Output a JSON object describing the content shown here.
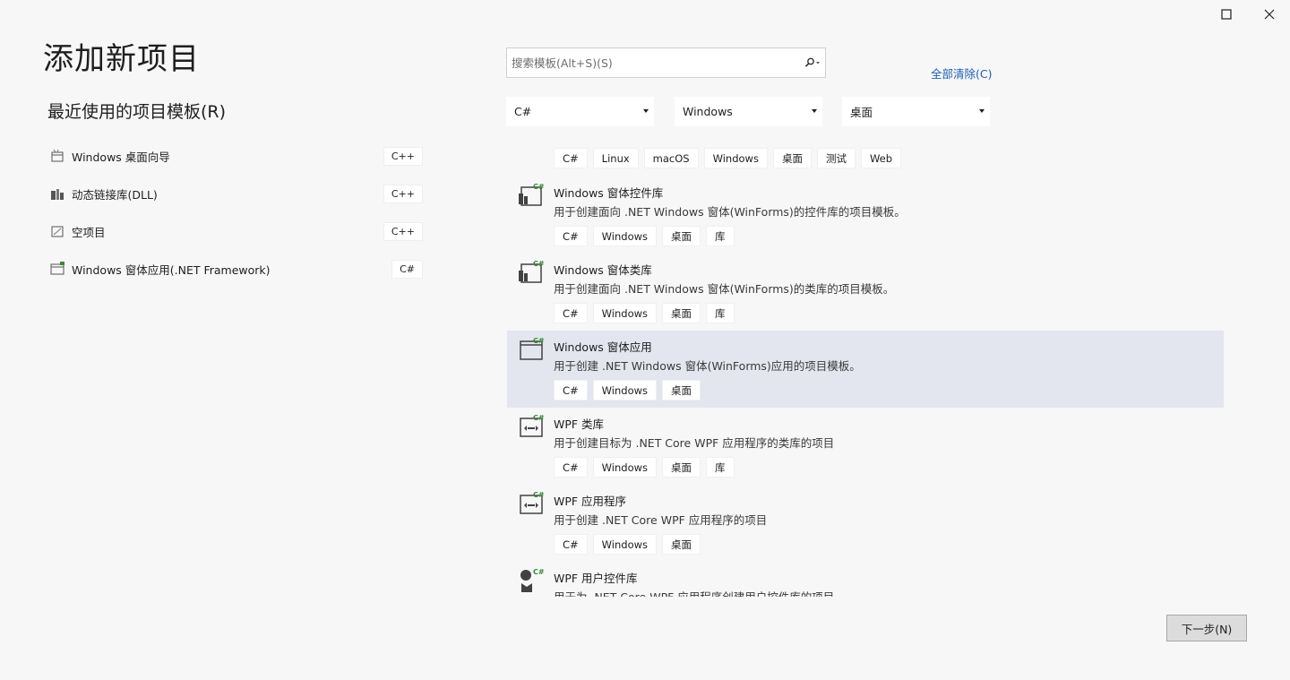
{
  "window": {
    "maximize_icon": "maximize-icon",
    "close_icon": "close-icon"
  },
  "page_title": "添加新项目",
  "recent": {
    "title": "最近使用的项目模板(R)",
    "items": [
      {
        "label": "Windows 桌面向导",
        "lang": "C++",
        "icon": "wizard-icon"
      },
      {
        "label": "动态链接库(DLL)",
        "lang": "C++",
        "icon": "dll-icon"
      },
      {
        "label": "空项目",
        "lang": "C++",
        "icon": "empty-project-icon"
      },
      {
        "label": "Windows 窗体应用(.NET Framework)",
        "lang": "C#",
        "icon": "winforms-app-icon"
      }
    ]
  },
  "search": {
    "placeholder": "搜索模板(Alt+S)(S)",
    "value": "",
    "icon": "search-icon"
  },
  "clear_all": "全部清除(C)",
  "filters": {
    "language": "C#",
    "platform": "Windows",
    "project_type": "桌面"
  },
  "top_tags": [
    "C#",
    "Linux",
    "macOS",
    "Windows",
    "桌面",
    "测试",
    "Web"
  ],
  "templates": [
    {
      "name": "Windows 窗体控件库",
      "desc": "用于创建面向 .NET Windows 窗体(WinForms)的控件库的项目模板。",
      "tags": [
        "C#",
        "Windows",
        "桌面",
        "库"
      ],
      "icon": "winforms-control-library-icon",
      "selected": false
    },
    {
      "name": "Windows 窗体类库",
      "desc": "用于创建面向 .NET Windows 窗体(WinForms)的类库的项目模板。",
      "tags": [
        "C#",
        "Windows",
        "桌面",
        "库"
      ],
      "icon": "winforms-class-library-icon",
      "selected": false
    },
    {
      "name": "Windows 窗体应用",
      "desc": "用于创建 .NET Windows 窗体(WinForms)应用的项目模板。",
      "tags": [
        "C#",
        "Windows",
        "桌面"
      ],
      "icon": "winforms-app-icon",
      "selected": true
    },
    {
      "name": "WPF 类库",
      "desc": "用于创建目标为 .NET Core WPF 应用程序的类库的项目",
      "tags": [
        "C#",
        "Windows",
        "桌面",
        "库"
      ],
      "icon": "wpf-class-library-icon",
      "selected": false
    },
    {
      "name": "WPF 应用程序",
      "desc": "用于创建 .NET Core WPF 应用程序的项目",
      "tags": [
        "C#",
        "Windows",
        "桌面"
      ],
      "icon": "wpf-app-icon",
      "selected": false
    },
    {
      "name": "WPF 用户控件库",
      "desc": "用于为 .NET Core WPF 应用程序创建用户控件库的项目",
      "tags": [],
      "icon": "wpf-user-control-library-icon",
      "selected": false
    }
  ],
  "next_button": "下一步(N)",
  "colors": {
    "accent_link": "#1a5fb4",
    "selected_row": "#e3e6ee",
    "csharp_badge": "#388a34",
    "background": "#f7f7f8"
  }
}
